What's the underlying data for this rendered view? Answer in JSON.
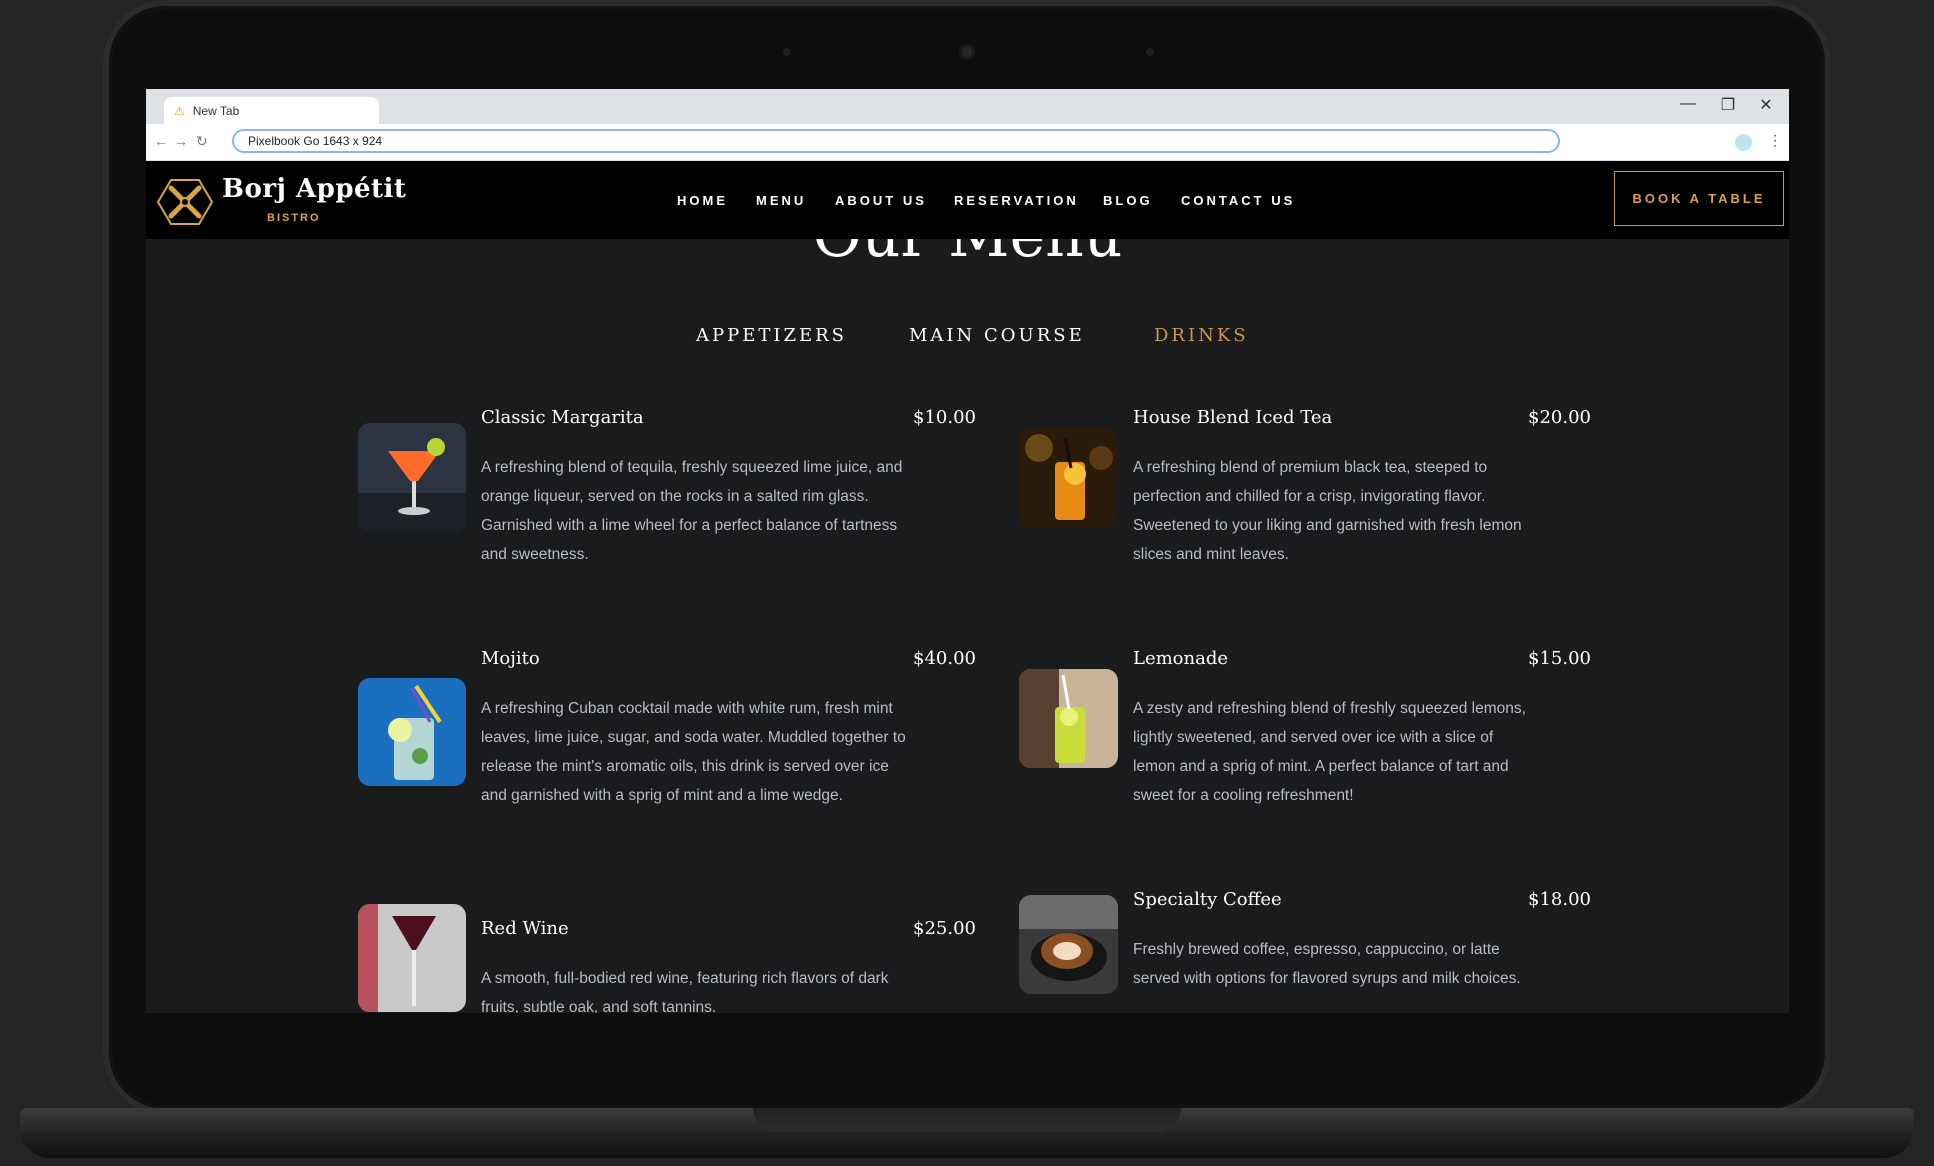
{
  "browser": {
    "tab_title": "New Tab",
    "address": "Pixelbook Go   1643 x 924",
    "minimize": "—",
    "restore": "❐",
    "close": "✕"
  },
  "site": {
    "brand": "Borj Appétit",
    "brand_sub": "BISTRO",
    "nav": [
      "HOME",
      "MENU",
      "ABOUT US",
      "RESERVATION",
      "BLOG",
      "CONTACT US"
    ],
    "cta": "BOOK A TABLE",
    "accent_color": "#c9974a"
  },
  "menu": {
    "title": "Our Menu",
    "tabs": [
      "APPETIZERS",
      "MAIN COURSE",
      "DRINKS"
    ],
    "active_tab": "DRINKS",
    "items": [
      {
        "name": "Classic Margarita",
        "price": "$10.00",
        "description": "A refreshing blend of tequila, freshly squeezed lime juice, and orange liqueur, served on the rocks in a salted rim glass. Garnished with a lime wheel for a perfect balance of tartness and sweetness."
      },
      {
        "name": "House Blend Iced Tea",
        "price": "$20.00",
        "description": "A refreshing blend of premium black tea, steeped to perfection and chilled for a crisp, invigorating flavor. Sweetened to your liking and garnished with fresh lemon slices and mint leaves."
      },
      {
        "name": "Mojito",
        "price": "$40.00",
        "description": "A refreshing Cuban cocktail made with white rum, fresh mint leaves, lime juice, sugar, and soda water. Muddled together to release the mint's aromatic oils, this drink is served over ice and garnished with a sprig of mint and a lime wedge."
      },
      {
        "name": "Lemonade",
        "price": "$15.00",
        "description": "A zesty and refreshing blend of freshly squeezed lemons, lightly sweetened, and served over ice with a slice of lemon and a sprig of mint. A perfect balance of tart and sweet for a cooling refreshment!"
      },
      {
        "name": "Red Wine",
        "price": "$25.00",
        "description": "A smooth, full-bodied red wine, featuring rich flavors of dark fruits, subtle oak, and soft tannins."
      },
      {
        "name": "Specialty Coffee",
        "price": "$18.00",
        "description": "Freshly brewed coffee, espresso, cappuccino, or latte served with options for flavored syrups and milk choices."
      }
    ]
  }
}
